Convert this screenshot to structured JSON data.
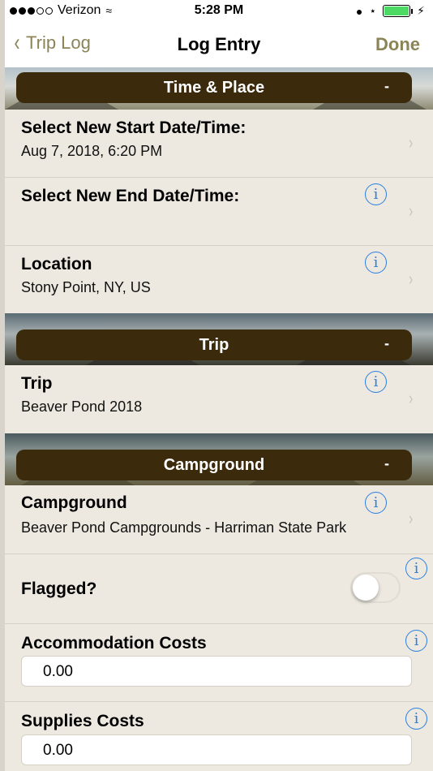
{
  "status_bar": {
    "carrier": "Verizon",
    "time": "5:28 PM",
    "signal_dots_filled": 3,
    "signal_dots_total": 5
  },
  "nav": {
    "back_label": "Trip Log",
    "title": "Log Entry",
    "done_label": "Done"
  },
  "sections": {
    "time_place": {
      "title": "Time & Place",
      "toggle": "-"
    },
    "trip": {
      "title": "Trip",
      "toggle": "-"
    },
    "campground": {
      "title": "Campground",
      "toggle": "-"
    }
  },
  "rows": {
    "start_date": {
      "title": "Select New Start Date/Time:",
      "value": "Aug 7, 2018, 6:20 PM"
    },
    "end_date": {
      "title": "Select New End Date/Time:",
      "value": ""
    },
    "location": {
      "title": "Location",
      "value": "Stony Point, NY, US"
    },
    "trip": {
      "title": "Trip",
      "value": "Beaver Pond 2018"
    },
    "campground": {
      "title": "Campground",
      "value": "Beaver Pond Campgrounds - Harriman State Park"
    },
    "flagged": {
      "title": "Flagged?",
      "on": false
    },
    "accommodation": {
      "title": "Accommodation Costs",
      "value": "0.00"
    },
    "supplies": {
      "title": "Supplies Costs",
      "value": "0.00"
    }
  },
  "icons": {
    "info": "i",
    "chevron": "›",
    "back": "‹"
  },
  "colors": {
    "accent": "#8b8457",
    "section_header": "#3b2a0b",
    "panel": "#ede9e0",
    "info": "#2a7fe0"
  }
}
